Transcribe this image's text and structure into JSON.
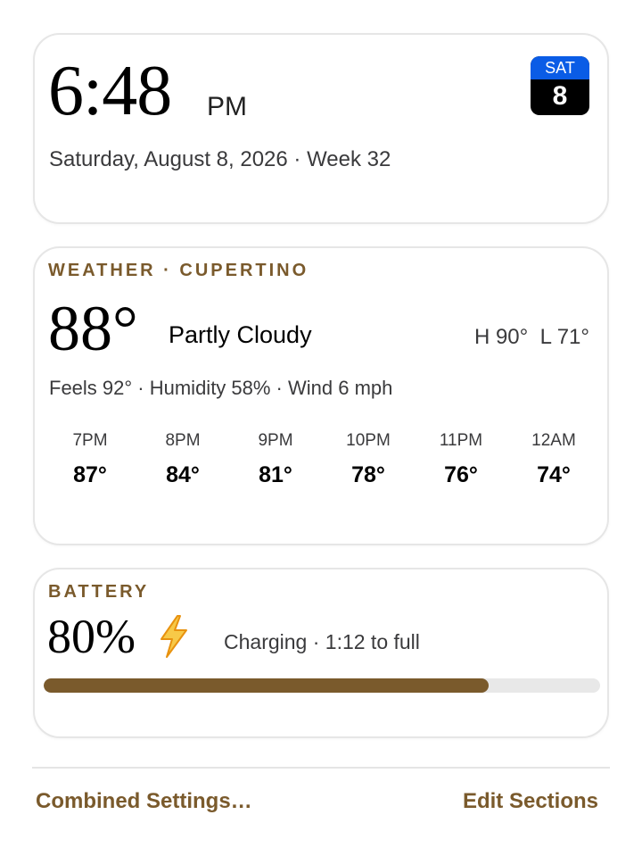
{
  "clock": {
    "time": "6:48",
    "ampm": "PM",
    "date_line": "Saturday, August 8, 2026 · Week 32",
    "calendar_badge": {
      "day": "SAT",
      "date": "8"
    }
  },
  "weather": {
    "title": "WEATHER · CUPERTINO",
    "temperature": "88°",
    "condition": "Partly Cloudy",
    "hi_lo": "H 90°  L 71°",
    "details": "Feels 92° · Humidity 58% · Wind 6 mph",
    "forecast": [
      {
        "hour": "7PM",
        "temp": "87°"
      },
      {
        "hour": "8PM",
        "temp": "84°"
      },
      {
        "hour": "9PM",
        "temp": "81°"
      },
      {
        "hour": "10PM",
        "temp": "78°"
      },
      {
        "hour": "11PM",
        "temp": "76°"
      },
      {
        "hour": "12AM",
        "temp": "74°"
      }
    ]
  },
  "battery": {
    "title": "BATTERY",
    "percent": "80%",
    "level": 0.8,
    "status": "Charging · 1:12 to full",
    "icon": "lightning-bolt-icon"
  },
  "footer": {
    "settings_label": "Combined Settings…",
    "edit_label": "Edit Sections"
  },
  "colors": {
    "accent": "#7a5a2c",
    "calendar_header": "#0a5ce6",
    "bolt": "#f5a623"
  }
}
